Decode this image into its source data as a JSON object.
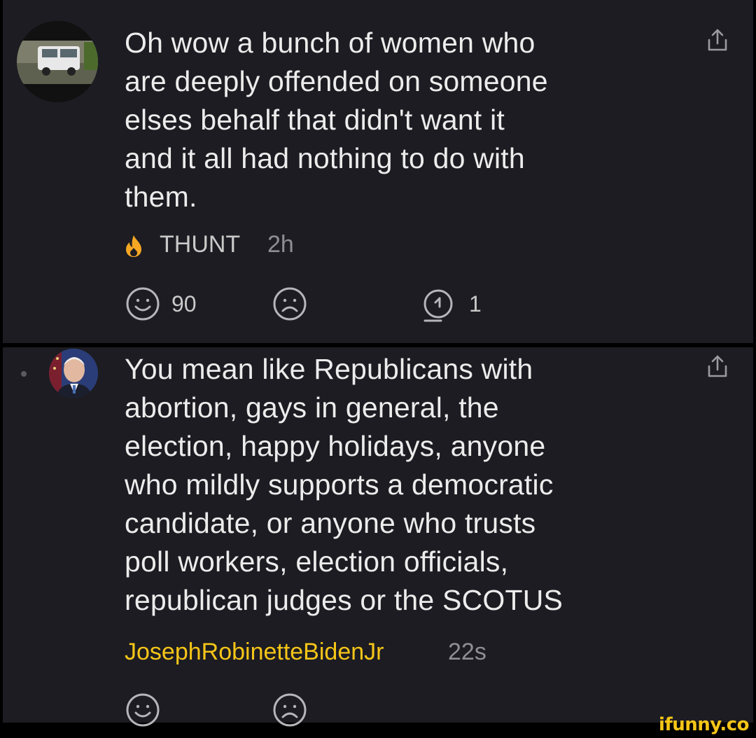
{
  "comments": [
    {
      "text": "Oh wow a bunch of women who\nare deeply offended on someone\nelses behalf that didn't want it\nand it all had nothing to do with\nthem.",
      "username": "THUNT",
      "time": "2h",
      "badge_icon": "flame-icon",
      "smile_count": "90",
      "reply_count": "1"
    },
    {
      "text": "You mean like Republicans with\nabortion, gays in general, the\nelection, happy holidays, anyone\nwho mildly supports a democratic\ncandidate, or anyone who trusts\npoll workers, election officials,\nrepublican judges or the SCOTUS",
      "username": "JosephRobinetteBidenJr",
      "time": "22s"
    }
  ],
  "watermark": "ifunny.co",
  "colors": {
    "background": "#1c1c22",
    "username_highlight": "#f5c518",
    "flame": "#f5a623",
    "muted": "#8e8e93"
  }
}
